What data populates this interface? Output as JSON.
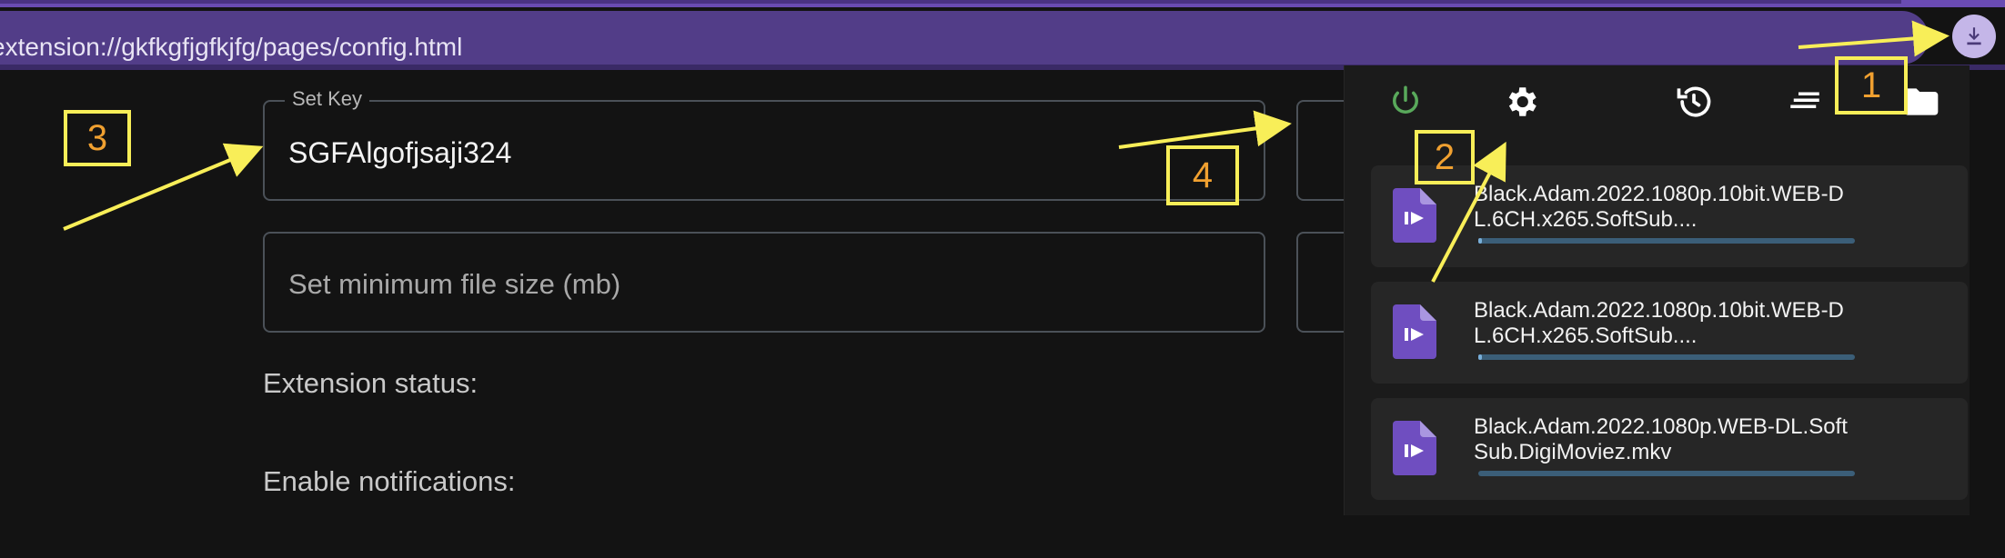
{
  "browser": {
    "url": "extension://gkfkgfjgfkjfg/pages/config.html",
    "download_icon": "download-icon"
  },
  "settings": {
    "key_label": "Set Key",
    "key_value": "SGFAlgofjsaji324",
    "min_size_placeholder": "Set minimum file size (mb)",
    "extension_status_label": "Extension status:",
    "notifications_label": "Enable notifications:"
  },
  "popup": {
    "toolbar": [
      "power-icon",
      "gear-icon",
      "history-icon",
      "list-icon",
      "folder-icon"
    ],
    "downloads": [
      {
        "name": "Black.Adam.2022.1080p.10bit.WEB-DL.6CH.x265.SoftSub....",
        "progress": 0.01
      },
      {
        "name": "Black.Adam.2022.1080p.10bit.WEB-DL.6CH.x265.SoftSub....",
        "progress": 0.01
      },
      {
        "name": "Black.Adam.2022.1080p.WEB-DL.SoftSub.DigiMoviez.mkv",
        "progress": 0.0
      }
    ]
  },
  "annotations": {
    "callout_1": "1",
    "callout_2": "2",
    "callout_3": "3",
    "callout_4": "4"
  },
  "colors": {
    "accent": "#6f4ec0",
    "callout": "#f8ee58",
    "callout_text": "#f0a030",
    "power": "#59a95b"
  }
}
